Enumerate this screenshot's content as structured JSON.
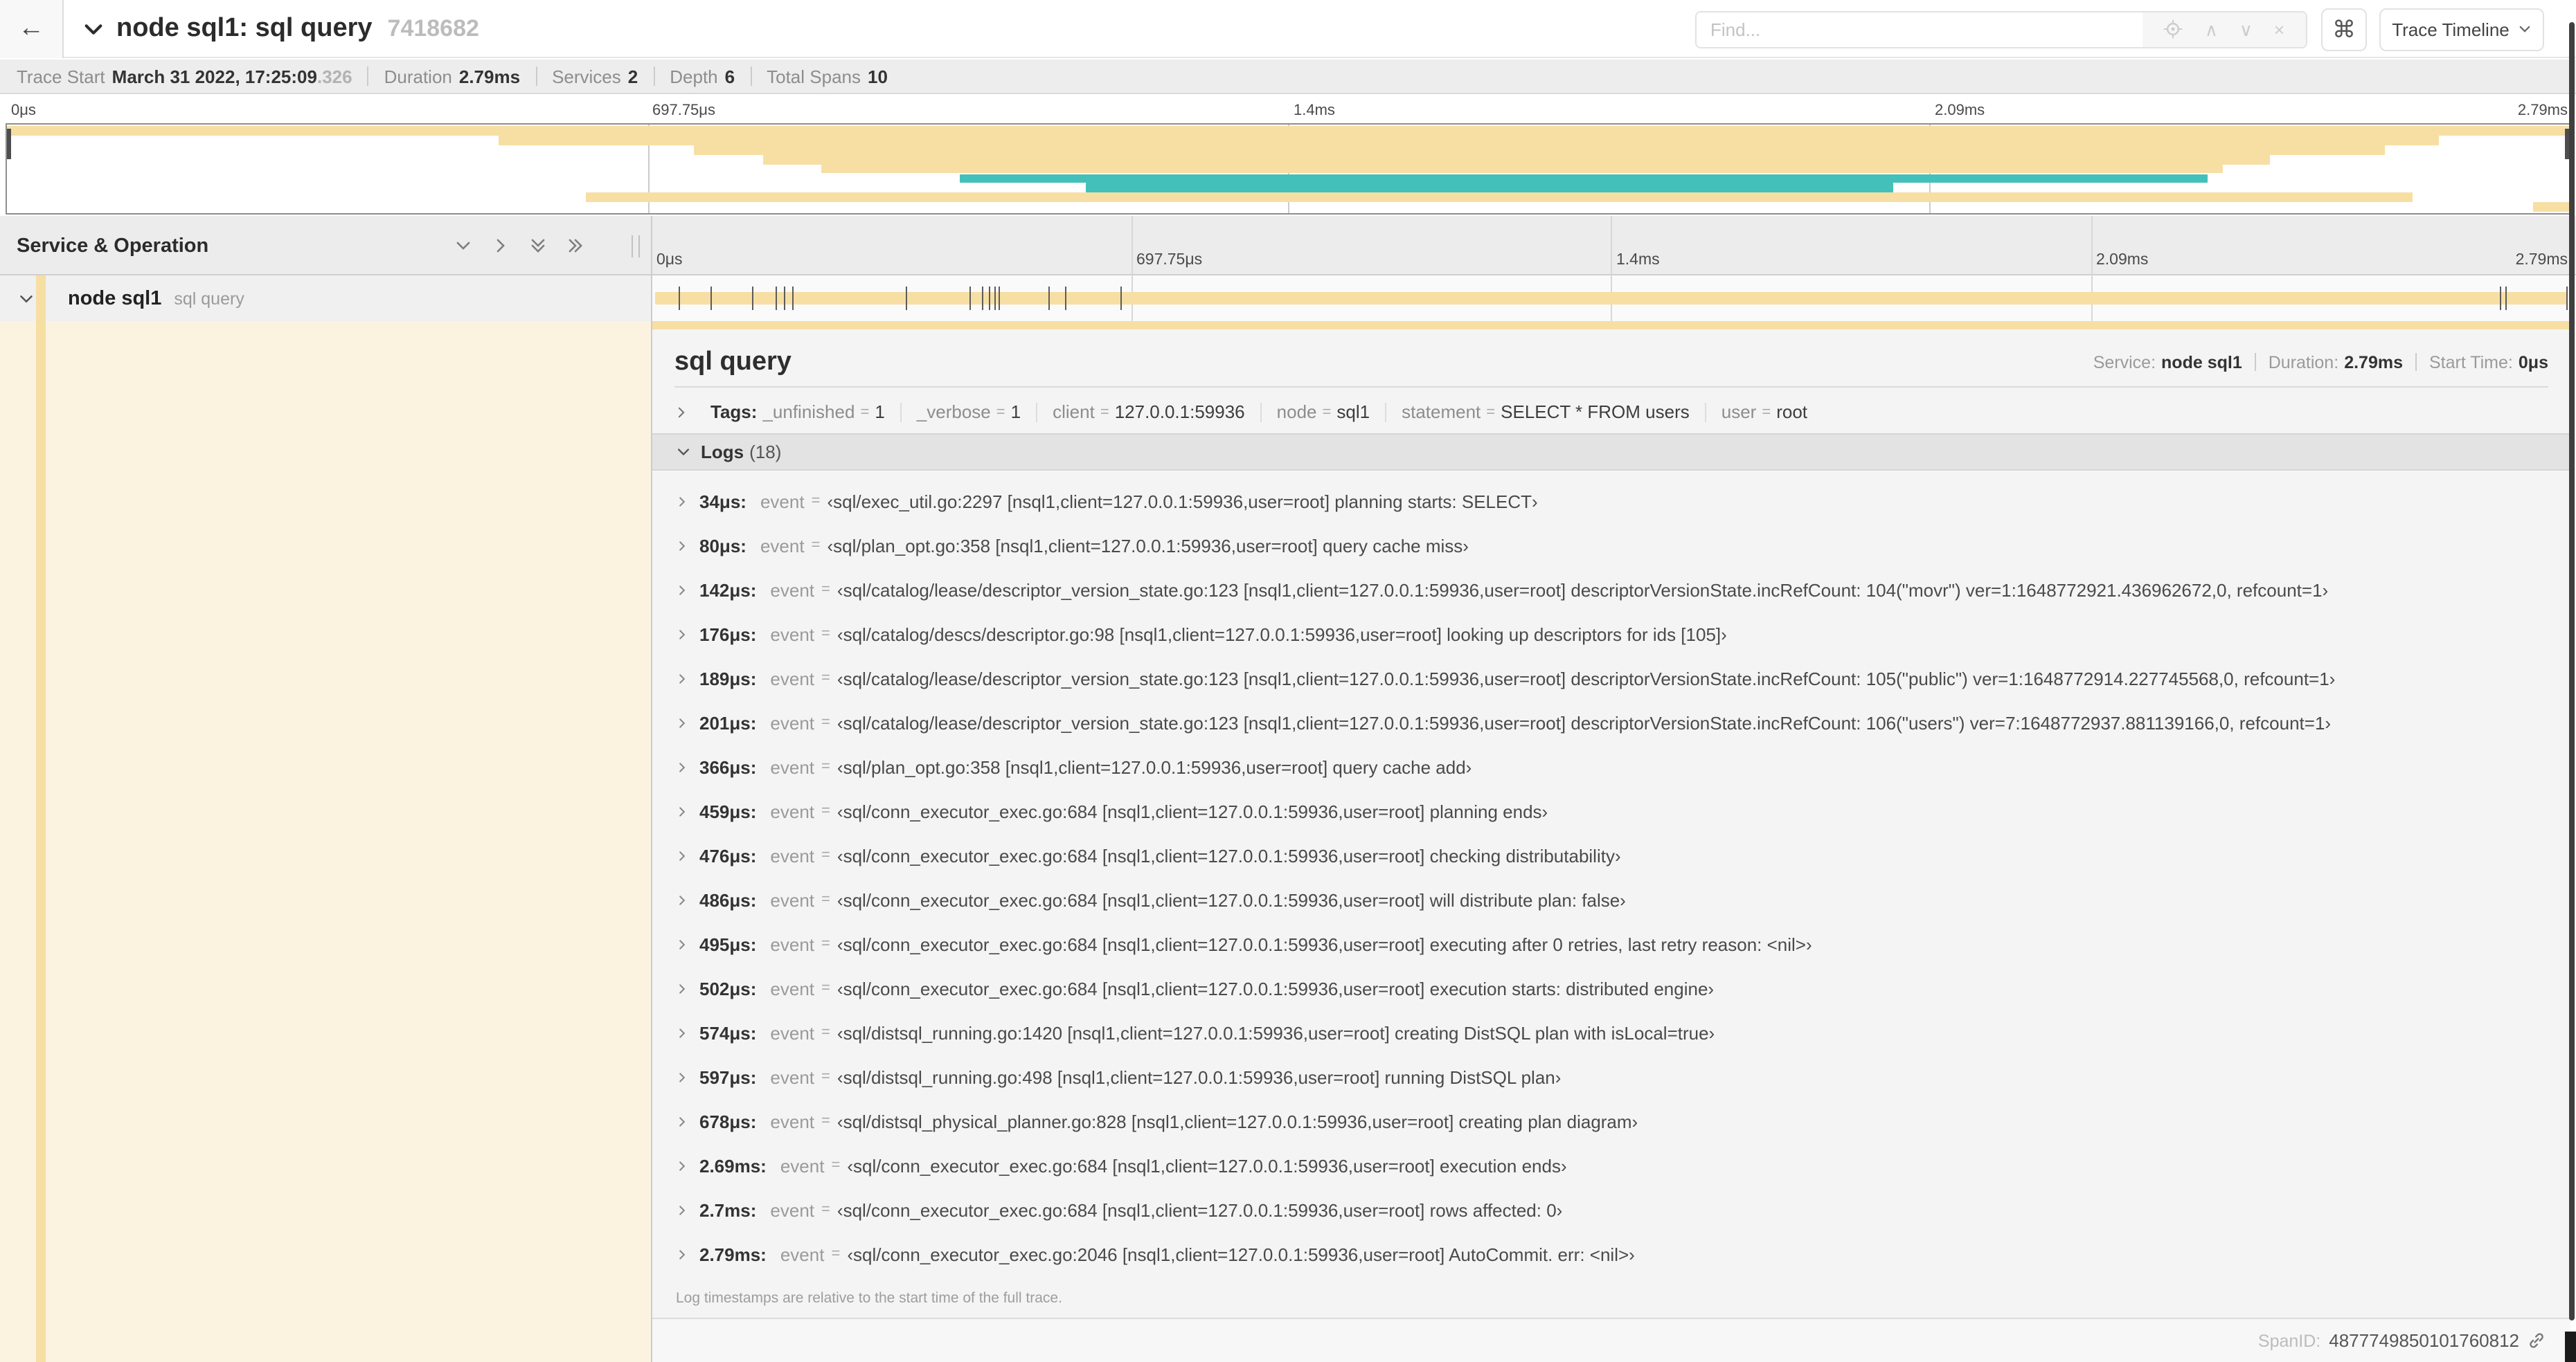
{
  "header": {
    "back_glyph": "←",
    "title": "node sql1: sql query",
    "trace_id": "7418682",
    "find_placeholder": "Find...",
    "find_prev_glyph": "∧",
    "find_next_glyph": "∨",
    "find_clear_glyph": "×",
    "cmd_glyph": "⌘",
    "view_label": "Trace Timeline"
  },
  "summary": {
    "trace_start_label": "Trace Start",
    "trace_start_value": "March 31 2022, 17:25:09",
    "trace_start_ms": ".326",
    "duration_label": "Duration",
    "duration_value": "2.79ms",
    "services_label": "Services",
    "services_value": "2",
    "depth_label": "Depth",
    "depth_value": "6",
    "total_spans_label": "Total Spans",
    "total_spans_value": "10"
  },
  "ticks": [
    "0μs",
    "697.75μs",
    "1.4ms",
    "2.09ms",
    "2.79ms"
  ],
  "tick_pcts": [
    0,
    25,
    50,
    75,
    100
  ],
  "grid_pcts": [
    25,
    50,
    75
  ],
  "colors": {
    "span_tan": "#f7dfa4",
    "span_teal": "#44c0ba",
    "selected_row_tint": "#fbf3df"
  },
  "minimap": {
    "spans": [
      {
        "row": 0,
        "start": 0,
        "end": 100,
        "color": "tan"
      },
      {
        "row": 1,
        "start": 19.2,
        "end": 94.9,
        "color": "tan"
      },
      {
        "row": 2,
        "start": 26.8,
        "end": 92.8,
        "color": "tan"
      },
      {
        "row": 3,
        "start": 29.5,
        "end": 88.3,
        "color": "tan"
      },
      {
        "row": 4,
        "start": 31.8,
        "end": 86.5,
        "color": "tan"
      },
      {
        "row": 5,
        "start": 37.2,
        "end": 85.9,
        "color": "teal"
      },
      {
        "row": 6,
        "start": 42.1,
        "end": 73.6,
        "color": "teal"
      },
      {
        "row": 7,
        "start": 22.6,
        "end": 93.9,
        "color": "tan"
      },
      {
        "row": 8,
        "start": 98.6,
        "end": 100,
        "color": "tan"
      }
    ]
  },
  "left_header": {
    "title": "Service & Operation"
  },
  "span_row": {
    "service": "node sql1",
    "operation": "sql query",
    "log_marker_pcts": [
      1.22,
      2.87,
      5.09,
      6.31,
      6.77,
      7.2,
      13.12,
      16.45,
      17.06,
      17.42,
      17.74,
      17.99,
      20.57,
      21.4,
      24.3,
      96.42,
      96.77,
      99.9
    ]
  },
  "detail": {
    "title": "sql query",
    "service_label": "Service:",
    "service_value": "node sql1",
    "duration_label": "Duration:",
    "duration_value": "2.79ms",
    "start_label": "Start Time:",
    "start_value": "0μs",
    "tags_label": "Tags:",
    "tags": [
      {
        "key": "_unfinished",
        "value": "1"
      },
      {
        "key": "_verbose",
        "value": "1"
      },
      {
        "key": "client",
        "value": "127.0.0.1:59936"
      },
      {
        "key": "node",
        "value": "sql1"
      },
      {
        "key": "statement",
        "value": "SELECT * FROM users"
      },
      {
        "key": "user",
        "value": "root"
      }
    ],
    "logs_label": "Logs",
    "logs_count": "(18)",
    "logs": [
      {
        "time": "34μs:",
        "key": "event",
        "value": "‹sql/exec_util.go:2297 [nsql1,client=127.0.0.1:59936,user=root] planning starts: SELECT›"
      },
      {
        "time": "80μs:",
        "key": "event",
        "value": "‹sql/plan_opt.go:358 [nsql1,client=127.0.0.1:59936,user=root] query cache miss›"
      },
      {
        "time": "142μs:",
        "key": "event",
        "value": "‹sql/catalog/lease/descriptor_version_state.go:123 [nsql1,client=127.0.0.1:59936,user=root] descriptorVersionState.incRefCount: 104(\"movr\") ver=1:1648772921.436962672,0, refcount=1›"
      },
      {
        "time": "176μs:",
        "key": "event",
        "value": "‹sql/catalog/descs/descriptor.go:98 [nsql1,client=127.0.0.1:59936,user=root] looking up descriptors for ids [105]›"
      },
      {
        "time": "189μs:",
        "key": "event",
        "value": "‹sql/catalog/lease/descriptor_version_state.go:123 [nsql1,client=127.0.0.1:59936,user=root] descriptorVersionState.incRefCount: 105(\"public\") ver=1:1648772914.227745568,0, refcount=1›"
      },
      {
        "time": "201μs:",
        "key": "event",
        "value": "‹sql/catalog/lease/descriptor_version_state.go:123 [nsql1,client=127.0.0.1:59936,user=root] descriptorVersionState.incRefCount: 106(\"users\") ver=7:1648772937.881139166,0, refcount=1›"
      },
      {
        "time": "366μs:",
        "key": "event",
        "value": "‹sql/plan_opt.go:358 [nsql1,client=127.0.0.1:59936,user=root] query cache add›"
      },
      {
        "time": "459μs:",
        "key": "event",
        "value": "‹sql/conn_executor_exec.go:684 [nsql1,client=127.0.0.1:59936,user=root] planning ends›"
      },
      {
        "time": "476μs:",
        "key": "event",
        "value": "‹sql/conn_executor_exec.go:684 [nsql1,client=127.0.0.1:59936,user=root] checking distributability›"
      },
      {
        "time": "486μs:",
        "key": "event",
        "value": "‹sql/conn_executor_exec.go:684 [nsql1,client=127.0.0.1:59936,user=root] will distribute plan: false›"
      },
      {
        "time": "495μs:",
        "key": "event",
        "value": "‹sql/conn_executor_exec.go:684 [nsql1,client=127.0.0.1:59936,user=root] executing after 0 retries, last retry reason: <nil>›"
      },
      {
        "time": "502μs:",
        "key": "event",
        "value": "‹sql/conn_executor_exec.go:684 [nsql1,client=127.0.0.1:59936,user=root] execution starts: distributed engine›"
      },
      {
        "time": "574μs:",
        "key": "event",
        "value": "‹sql/distsql_running.go:1420 [nsql1,client=127.0.0.1:59936,user=root] creating DistSQL plan with isLocal=true›"
      },
      {
        "time": "597μs:",
        "key": "event",
        "value": "‹sql/distsql_running.go:498 [nsql1,client=127.0.0.1:59936,user=root] running DistSQL plan›"
      },
      {
        "time": "678μs:",
        "key": "event",
        "value": "‹sql/distsql_physical_planner.go:828 [nsql1,client=127.0.0.1:59936,user=root] creating plan diagram›"
      },
      {
        "time": "2.69ms:",
        "key": "event",
        "value": "‹sql/conn_executor_exec.go:684 [nsql1,client=127.0.0.1:59936,user=root] execution ends›"
      },
      {
        "time": "2.7ms:",
        "key": "event",
        "value": "‹sql/conn_executor_exec.go:684 [nsql1,client=127.0.0.1:59936,user=root] rows affected: 0›"
      },
      {
        "time": "2.79ms:",
        "key": "event",
        "value": "‹sql/conn_executor_exec.go:2046 [nsql1,client=127.0.0.1:59936,user=root] AutoCommit. err: <nil>›"
      }
    ],
    "footer_note": "Log timestamps are relative to the start time of the full trace.",
    "spanid_label": "SpanID:",
    "spanid_value": "4877749850101760812"
  }
}
